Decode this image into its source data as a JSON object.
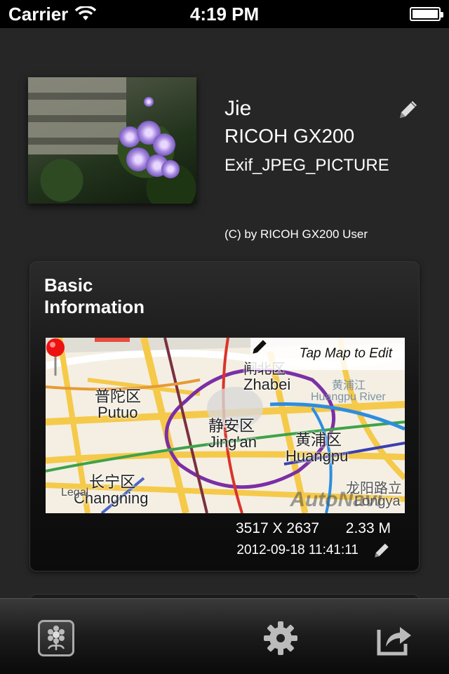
{
  "status_bar": {
    "carrier": "Carrier",
    "time": "4:19 PM",
    "battery_level": 1.0
  },
  "photo": {
    "name": "Jie",
    "model": "RICOH GX200",
    "description": "Exif_JPEG_PICTURE",
    "copyright": "(C) by RICOH GX200 User"
  },
  "basic_info": {
    "title": "Basic Information",
    "map": {
      "tap_hint": "Tap Map to Edit",
      "legal": "Legal",
      "watermark": "AutoNavi",
      "labels": {
        "putuo_cn": "普陀区",
        "putuo_en": "Putuo",
        "zhabei_cn": "闸北区",
        "zhabei_en": "Zhabei",
        "huangpujiang_cn": "黄浦江",
        "huangpu_river": "Huangpu River",
        "jingan_cn": "静安区",
        "jingan_en": "Jing'an",
        "huangpu_cn": "黄浦区",
        "huangpu_en": "Huangpu",
        "changning_cn": "长宁区",
        "changning_en": "Changning",
        "longyang_cn": "龙阳路立",
        "longyang_en": "Longya"
      }
    },
    "dimensions": "3517 X 2637",
    "file_size": "2.33 M",
    "date": "2012-09-18 11:41:11"
  },
  "colors": {
    "background": "#262626",
    "card": "#111111",
    "toolbar": "#1b1b1b"
  },
  "icons": {
    "edit": "pencil-icon",
    "photos": "photo-album-icon",
    "settings": "gear-icon",
    "share": "share-icon"
  }
}
